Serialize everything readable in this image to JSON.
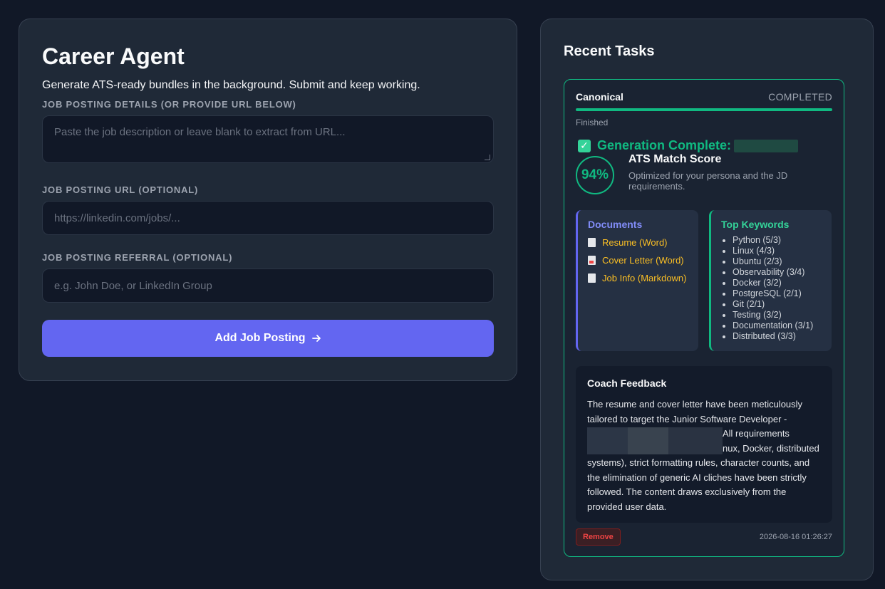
{
  "form": {
    "title": "Career Agent",
    "subtitle": "Generate ATS-ready bundles in the background. Submit and keep working.",
    "details_label": "JOB POSTING DETAILS (OR PROVIDE URL BELOW)",
    "details_placeholder": "Paste the job description or leave blank to extract from URL...",
    "url_label": "JOB POSTING URL (OPTIONAL)",
    "url_placeholder": "https://linkedin.com/jobs/...",
    "referral_label": "JOB POSTING REFERRAL (OPTIONAL)",
    "referral_placeholder": "e.g. John Doe, or LinkedIn Group",
    "submit_label": "Add Job Posting",
    "submit_icon": "arrow-right-icon"
  },
  "recent": {
    "title": "Recent Tasks",
    "task": {
      "company": "Canonical",
      "status": "COMPLETED",
      "progress_percent": 100,
      "phase": "Finished",
      "generation_title": "Generation Complete:",
      "score": "94%",
      "score_title": "ATS Match Score",
      "score_desc": "Optimized for your persona and the JD requirements.",
      "documents_title": "Documents",
      "documents": [
        "Resume (Word)",
        "Cover Letter (Word)",
        "Job Info (Markdown)"
      ],
      "keywords_title": "Top Keywords",
      "keywords": [
        "Python (5/3)",
        "Linux (4/3)",
        "Ubuntu (2/3)",
        "Observability (3/4)",
        "Docker (3/2)",
        "PostgreSQL (2/1)",
        "Git (2/1)",
        "Testing (3/2)",
        "Documentation (3/1)",
        "Distributed (3/3)"
      ],
      "coach_title": "Coach Feedback",
      "coach_text": "The resume and cover letter have been meticulously tailored to target the Junior Software Developer - ",
      "coach_text2": "All requirements ",
      "coach_text3": "nux, Docker, distributed systems), strict formatting rules, character counts, and the elimination of generic AI cliches have been strictly followed. The content draws exclusively from the provided user data.",
      "remove_label": "Remove",
      "timestamp": "2026-08-16 01:26:27"
    }
  },
  "colors": {
    "background": "#111827",
    "card": "#1f2937",
    "accent": "#6366f1",
    "success": "#10b981",
    "warning": "#fbbf24",
    "danger": "#ef4444"
  }
}
